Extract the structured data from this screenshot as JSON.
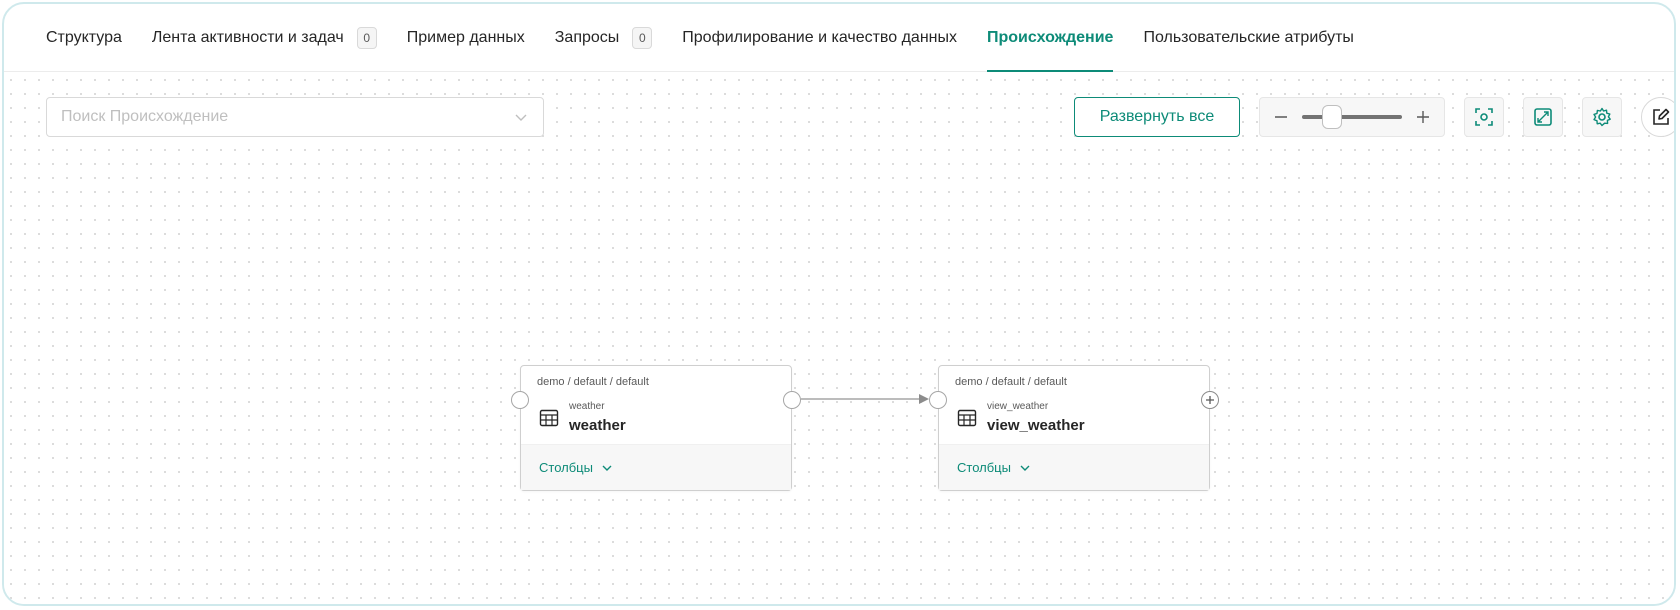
{
  "tabs": [
    {
      "label": "Структура"
    },
    {
      "label": "Лента активности и задач",
      "count": "0"
    },
    {
      "label": "Пример данных"
    },
    {
      "label": "Запросы",
      "count": "0"
    },
    {
      "label": "Профилирование и качество данных"
    },
    {
      "label": "Происхождение",
      "active": true
    },
    {
      "label": "Пользовательские атрибуты"
    }
  ],
  "toolbar": {
    "search_placeholder": "Поиск Происхождение",
    "expand_label": "Развернуть все",
    "zoom_value": 0.25
  },
  "nodes": [
    {
      "path": "demo / default / default",
      "subtitle": "weather",
      "name": "weather",
      "columns_label": "Столбцы"
    },
    {
      "path": "demo / default / default",
      "subtitle": "view_weather",
      "name": "view_weather",
      "columns_label": "Столбцы"
    }
  ],
  "colors": {
    "accent": "#0d8b78",
    "frame": "#cfe9ec"
  },
  "icons": [
    "chevron-down-icon",
    "minus-icon",
    "plus-icon",
    "fit-view-icon",
    "fullscreen-icon",
    "gear-icon",
    "edit-icon",
    "table-icon"
  ]
}
